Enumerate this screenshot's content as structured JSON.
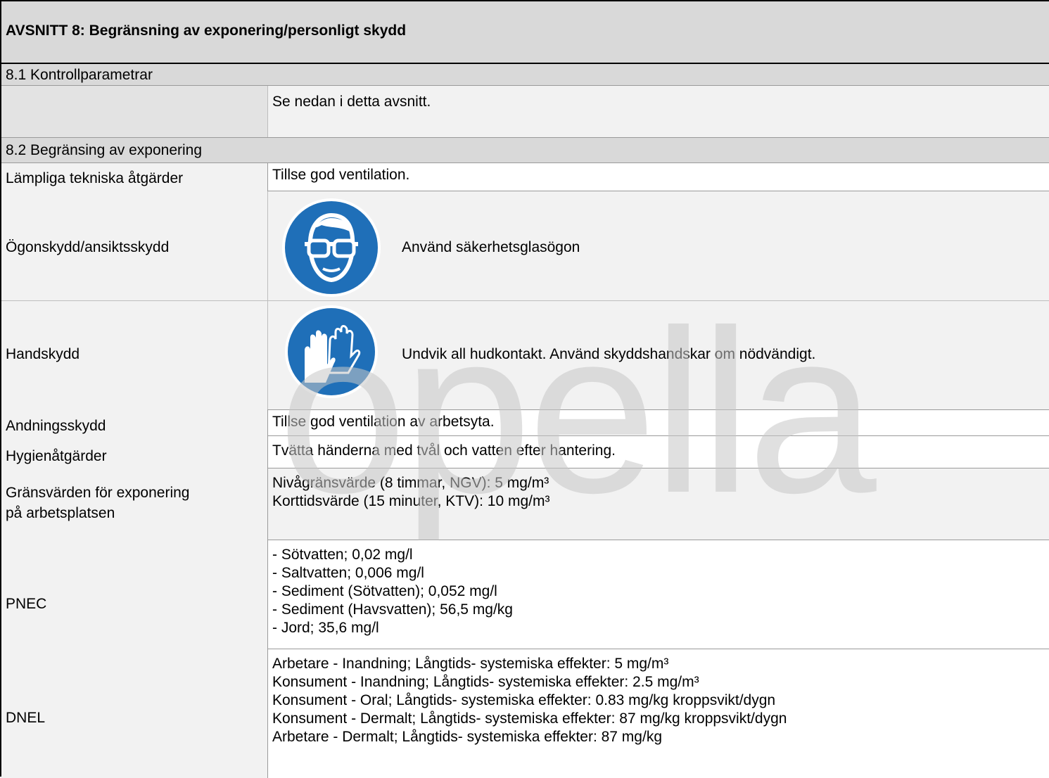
{
  "section_title": "AVSNITT 8: Begränsning av exponering/personligt skydd",
  "s81": {
    "heading": "8.1 Kontrollparametrar",
    "text": "Se nedan i detta avsnitt."
  },
  "s82": {
    "heading": "8.2 Begränsing av exponering"
  },
  "rows": {
    "technical": {
      "label": "Lämpliga tekniska åtgärder",
      "value": "Tillse god ventilation."
    },
    "eye": {
      "label": "Ögonskydd/ansiktsskydd",
      "value": "Använd säkerhetsglasögon",
      "icon": "safety-goggles-icon",
      "icon_color": "#1f6fb8"
    },
    "hand": {
      "label": "Handskydd",
      "value": "Undvik all hudkontakt. Använd skyddshandskar om nödvändigt.",
      "icon": "protective-gloves-icon",
      "icon_color": "#1f6fb8"
    },
    "breath": {
      "label": "Andningsskydd",
      "value": "Tillse god ventilation av arbetsyta."
    },
    "hygiene": {
      "label": "Hygienåtgärder",
      "value": "Tvätta händerna med tvål och vatten efter hantering."
    },
    "limits": {
      "label_1": "Gränsvärden för exponering",
      "label_2": "på arbetsplatsen",
      "lines": [
        "Nivågränsvärde (8 timmar, NGV): 5 mg/m³",
        "Korttidsvärde (15 minuter, KTV): 10 mg/m³"
      ]
    },
    "pnec": {
      "label": "PNEC",
      "lines": [
        "- Sötvatten; 0,02 mg/l",
        "- Saltvatten; 0,006 mg/l",
        "- Sediment (Sötvatten); 0,052 mg/l",
        "- Sediment (Havsvatten); 56,5 mg/kg",
        "- Jord; 35,6 mg/l"
      ]
    },
    "dnel": {
      "label": "DNEL",
      "lines": [
        "Arbetare - Inandning; Långtids- systemiska effekter: 5 mg/m³",
        "Konsument - Inandning; Långtids- systemiska effekter: 2.5 mg/m³",
        "Konsument - Oral; Långtids- systemiska effekter: 0.83 mg/kg kroppsvikt/dygn",
        "Konsument - Dermalt; Långtids- systemiska effekter: 87 mg/kg kroppsvikt/dygn",
        "Arbetare - Dermalt; Långtids- systemiska effekter: 87 mg/kg"
      ]
    }
  },
  "watermark": "opella"
}
